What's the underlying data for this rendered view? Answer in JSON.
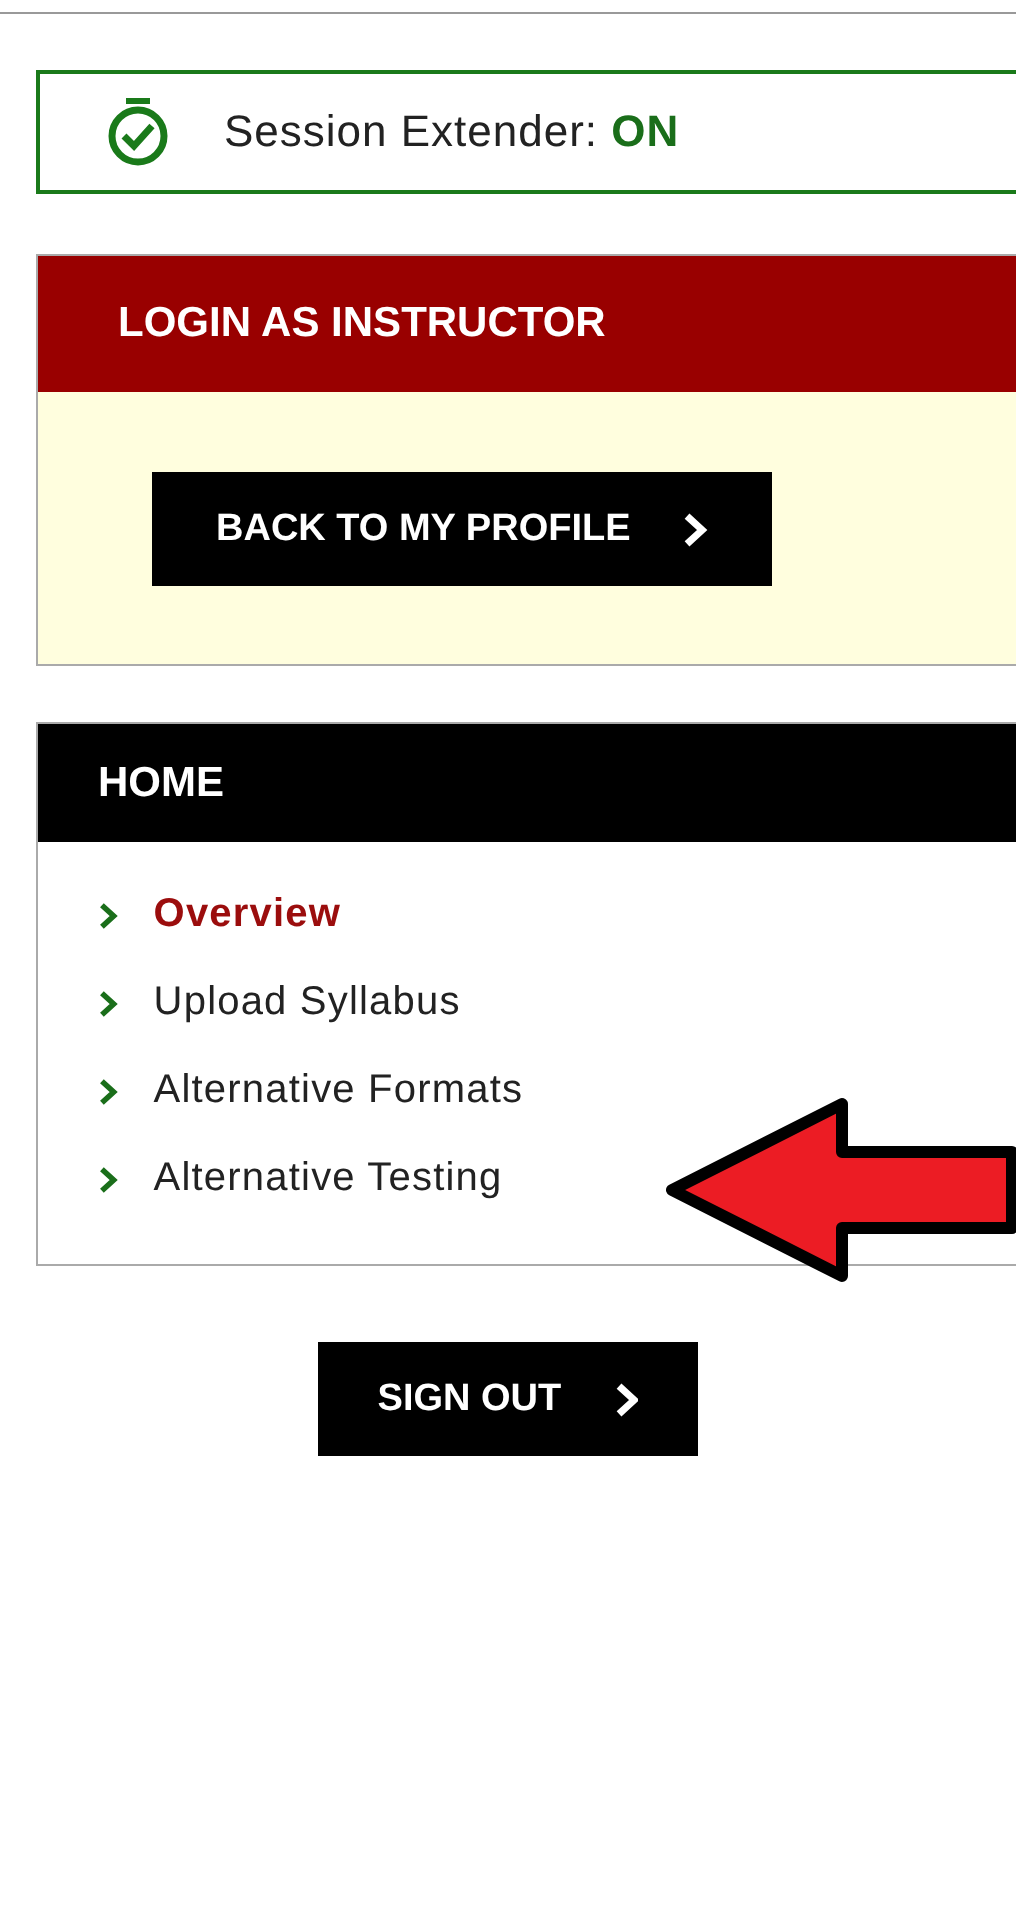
{
  "session": {
    "text": "Session Extender: **ON**",
    "on": true
  },
  "login_panel": {
    "title": "LOGIN AS INSTRUCTOR",
    "button": "BACK TO MY PROFILE"
  },
  "home_panel": {
    "title": "HOME",
    "items": [
      {
        "label": "Overview",
        "selected": true
      },
      {
        "label": "Upload Syllabus",
        "selected": false
      },
      {
        "label": "Alternative Formats",
        "selected": false
      },
      {
        "label": "Alternative Testing",
        "selected": false
      }
    ]
  },
  "sign_out": "SIGN OUT"
}
